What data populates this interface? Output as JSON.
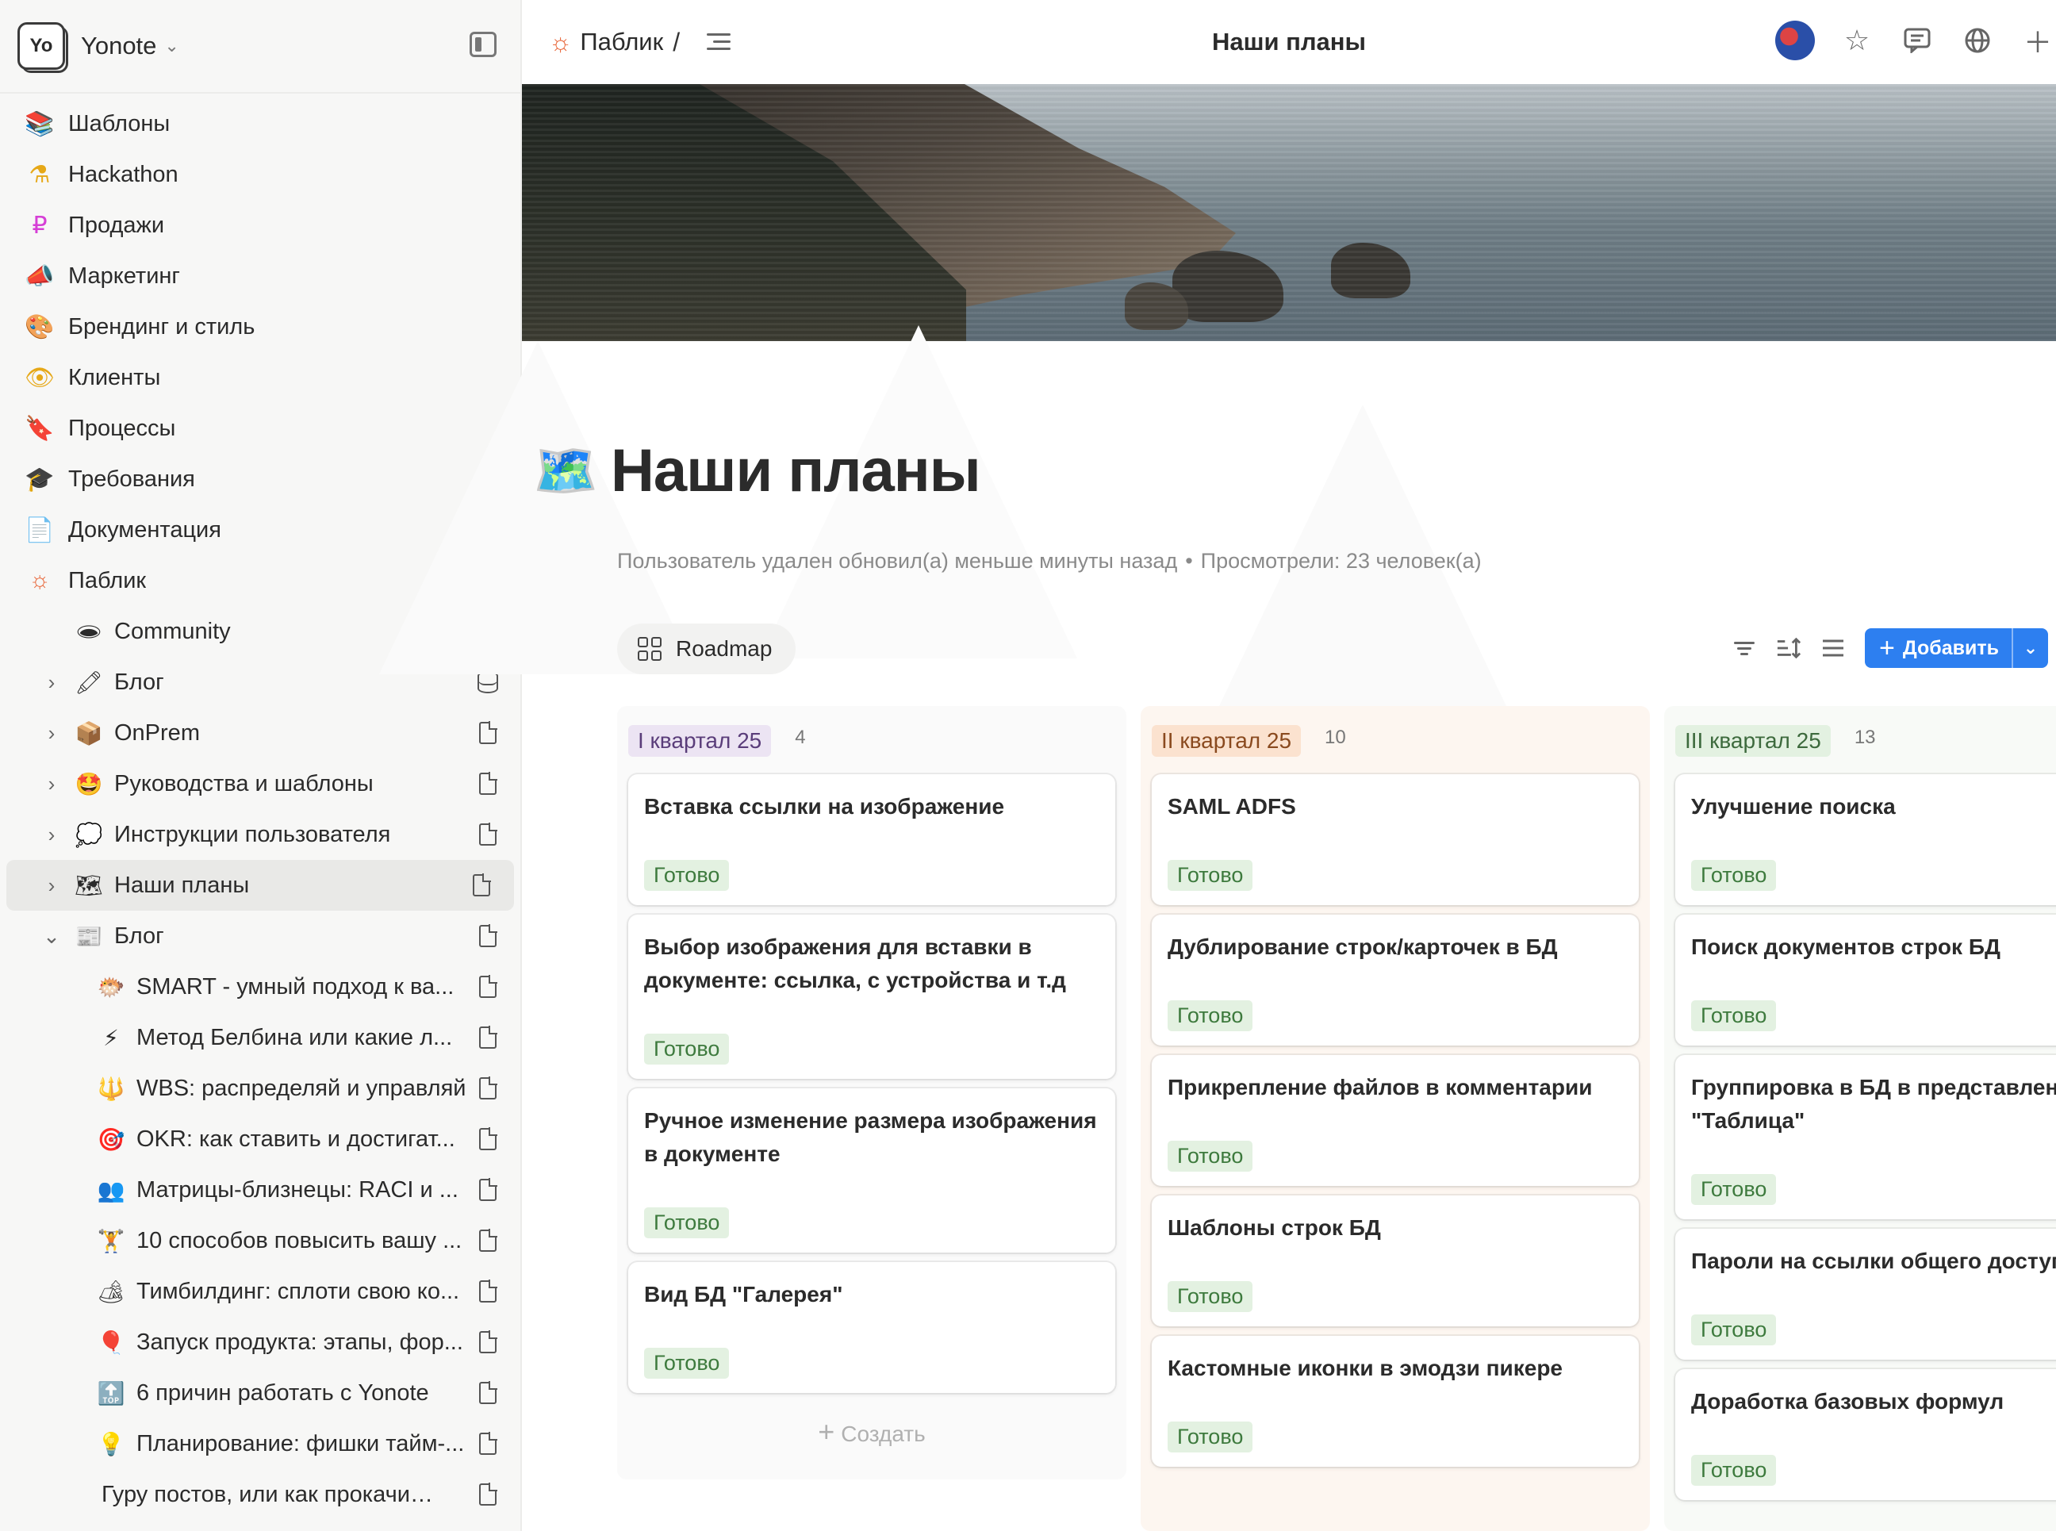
{
  "workspace": {
    "logo": "Yo",
    "name": "Yonote"
  },
  "sidebar": {
    "top_items": [
      {
        "icon": "library-icon",
        "glyph": "📚",
        "label": "Шаблоны",
        "color": "#4a5a8a"
      },
      {
        "icon": "flask-icon",
        "glyph": "⚗",
        "label": "Hackathon",
        "color": "#e6a817"
      },
      {
        "icon": "ruble-icon",
        "glyph": "₽",
        "label": "Продажи",
        "color": "#d63fd6"
      },
      {
        "icon": "megaphone-icon",
        "glyph": "📣",
        "label": "Маркетинг",
        "color": "#d63fd6"
      },
      {
        "icon": "palette-icon",
        "glyph": "🎨",
        "label": "Брендинг и стиль",
        "color": "#1aa58a"
      },
      {
        "icon": "eye-icon",
        "glyph": "👁",
        "label": "Клиенты",
        "color": "#e6a817"
      },
      {
        "icon": "bookmark-icon",
        "glyph": "🔖",
        "label": "Процессы",
        "color": "#2d6be0"
      },
      {
        "icon": "graduation-cap-icon",
        "glyph": "🎓",
        "label": "Требования",
        "color": "#d63fd6"
      },
      {
        "icon": "document-list-icon",
        "glyph": "📄",
        "label": "Документация",
        "color": "#7a4ad6"
      },
      {
        "icon": "sun-icon",
        "glyph": "☼",
        "label": "Паблик",
        "color": "#e8673a"
      }
    ],
    "sub_items": [
      {
        "emoji": "🕳",
        "label": "Community",
        "arrow": false,
        "right": "doc"
      },
      {
        "emoji": "🖍",
        "label": "Блог",
        "arrow": true,
        "right": "db"
      },
      {
        "emoji": "📦",
        "label": "OnPrem",
        "arrow": true,
        "right": "doc"
      },
      {
        "emoji": "🤩",
        "label": "Руководства и шаблоны",
        "arrow": true,
        "right": "doc"
      },
      {
        "emoji": "💭",
        "label": "Инструкции пользователя",
        "arrow": true,
        "right": "doc"
      },
      {
        "emoji": "🗺",
        "label": "Наши планы",
        "arrow": true,
        "right": "doc",
        "active": true
      },
      {
        "emoji": "📰",
        "label": "Блог",
        "arrow": "open",
        "right": "doc"
      }
    ],
    "blog_items": [
      {
        "emoji": "🐡",
        "label": "SMART - умный подход к ва..."
      },
      {
        "emoji": "⚡",
        "label": "Метод Белбина или какие л..."
      },
      {
        "emoji": "🔱",
        "label": "WBS: распределяй и управляй"
      },
      {
        "emoji": "🎯",
        "label": "OKR: как ставить и достигат..."
      },
      {
        "emoji": "👥",
        "label": "Матрицы-близнецы: RACI и ..."
      },
      {
        "emoji": "🏋",
        "label": "10 способов повысить вашу ..."
      },
      {
        "emoji": "🏕",
        "label": "Тимбилдинг: сплоти свою ко..."
      },
      {
        "emoji": "🎈",
        "label": "Запуск продукта: этапы, фор..."
      },
      {
        "emoji": "🔝",
        "label": "6 причин работать с Yonote"
      },
      {
        "emoji": "💡",
        "label": "Планирование: фишки тайм-..."
      },
      {
        "emoji": "",
        "label": "Гуру постов, или как прокачива..."
      }
    ]
  },
  "topbar": {
    "breadcrumb": "Паблик",
    "slash": "/",
    "center_title": "Наши планы"
  },
  "page": {
    "emoji": "🗺️",
    "title": "Наши планы",
    "meta_updated": "Пользователь удален обновил(а) меньше минуты назад",
    "meta_views": "Просмотрели: 23 человек(а)",
    "view_tab": "Roadmap",
    "add_label": "Добавить"
  },
  "board": {
    "status_label": "Готово",
    "create_label": "Создать",
    "columns": [
      {
        "title": "I квартал 25",
        "count": "4",
        "badge_bg": "#ece4f3",
        "badge_fg": "#5a3d7a",
        "col_bg": "#fafafa",
        "cards": [
          {
            "title": "Вставка ссылки на изображение"
          },
          {
            "title": "Выбор изображения для вставки в документе: ссылка, с устройства и т.д"
          },
          {
            "title": "Ручное изменение размера изображения в документе"
          },
          {
            "title": "Вид БД \"Галерея\""
          }
        ]
      },
      {
        "title": "II квартал 25",
        "count": "10",
        "badge_bg": "#fbe2cf",
        "badge_fg": "#8a4a1f",
        "col_bg": "#fdf6f0",
        "cards": [
          {
            "title": "SAML ADFS"
          },
          {
            "title": "Дублирование строк/карточек в БД"
          },
          {
            "title": "Прикрепление файлов в комментарии"
          },
          {
            "title": "Шаблоны строк БД"
          },
          {
            "title": "Кастомные иконки в эмодзи пикере"
          }
        ]
      },
      {
        "title": "III квартал 25",
        "count": "13",
        "badge_bg": "#e3f1e1",
        "badge_fg": "#3d6a3d",
        "col_bg": "#f8faf7",
        "cards": [
          {
            "title": "Улучшение поиска"
          },
          {
            "title": "Поиск документов строк БД"
          },
          {
            "title": "Группировка в БД в представлении \"Таблица\""
          },
          {
            "title": "Пароли на ссылки общего доступа"
          },
          {
            "title": "Доработка базовых формул"
          }
        ]
      }
    ]
  }
}
